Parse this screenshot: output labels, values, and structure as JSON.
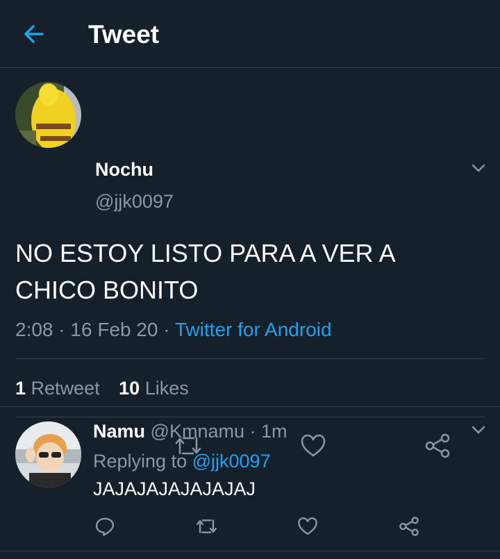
{
  "header": {
    "title": "Tweet",
    "back_icon": "arrow-left-icon"
  },
  "main_tweet": {
    "author_name": "Nochu",
    "author_handle": "@jjk0097",
    "text": "NO ESTOY LISTO PARA A VER A CHICO BONITO",
    "time": "2:08",
    "date": "16 Feb 20",
    "source": "Twitter for Android",
    "retweets_count": "1",
    "retweets_label": "Retweet",
    "likes_count": "10",
    "likes_label": "Likes"
  },
  "reply": {
    "author_name": "Namu",
    "author_handle": "@Kmnamu",
    "time": "1m",
    "replying_label": "Replying to",
    "replying_to": "@jjk0097",
    "text": "JAJAJAJAJAJAJAJ"
  },
  "icons": [
    "reply-icon",
    "retweet-icon",
    "like-icon",
    "share-icon",
    "chevron-down-icon"
  ],
  "colors": {
    "background": "#15202b",
    "accent": "#1da1f2",
    "muted": "#8899a6",
    "divider": "#38444d"
  }
}
